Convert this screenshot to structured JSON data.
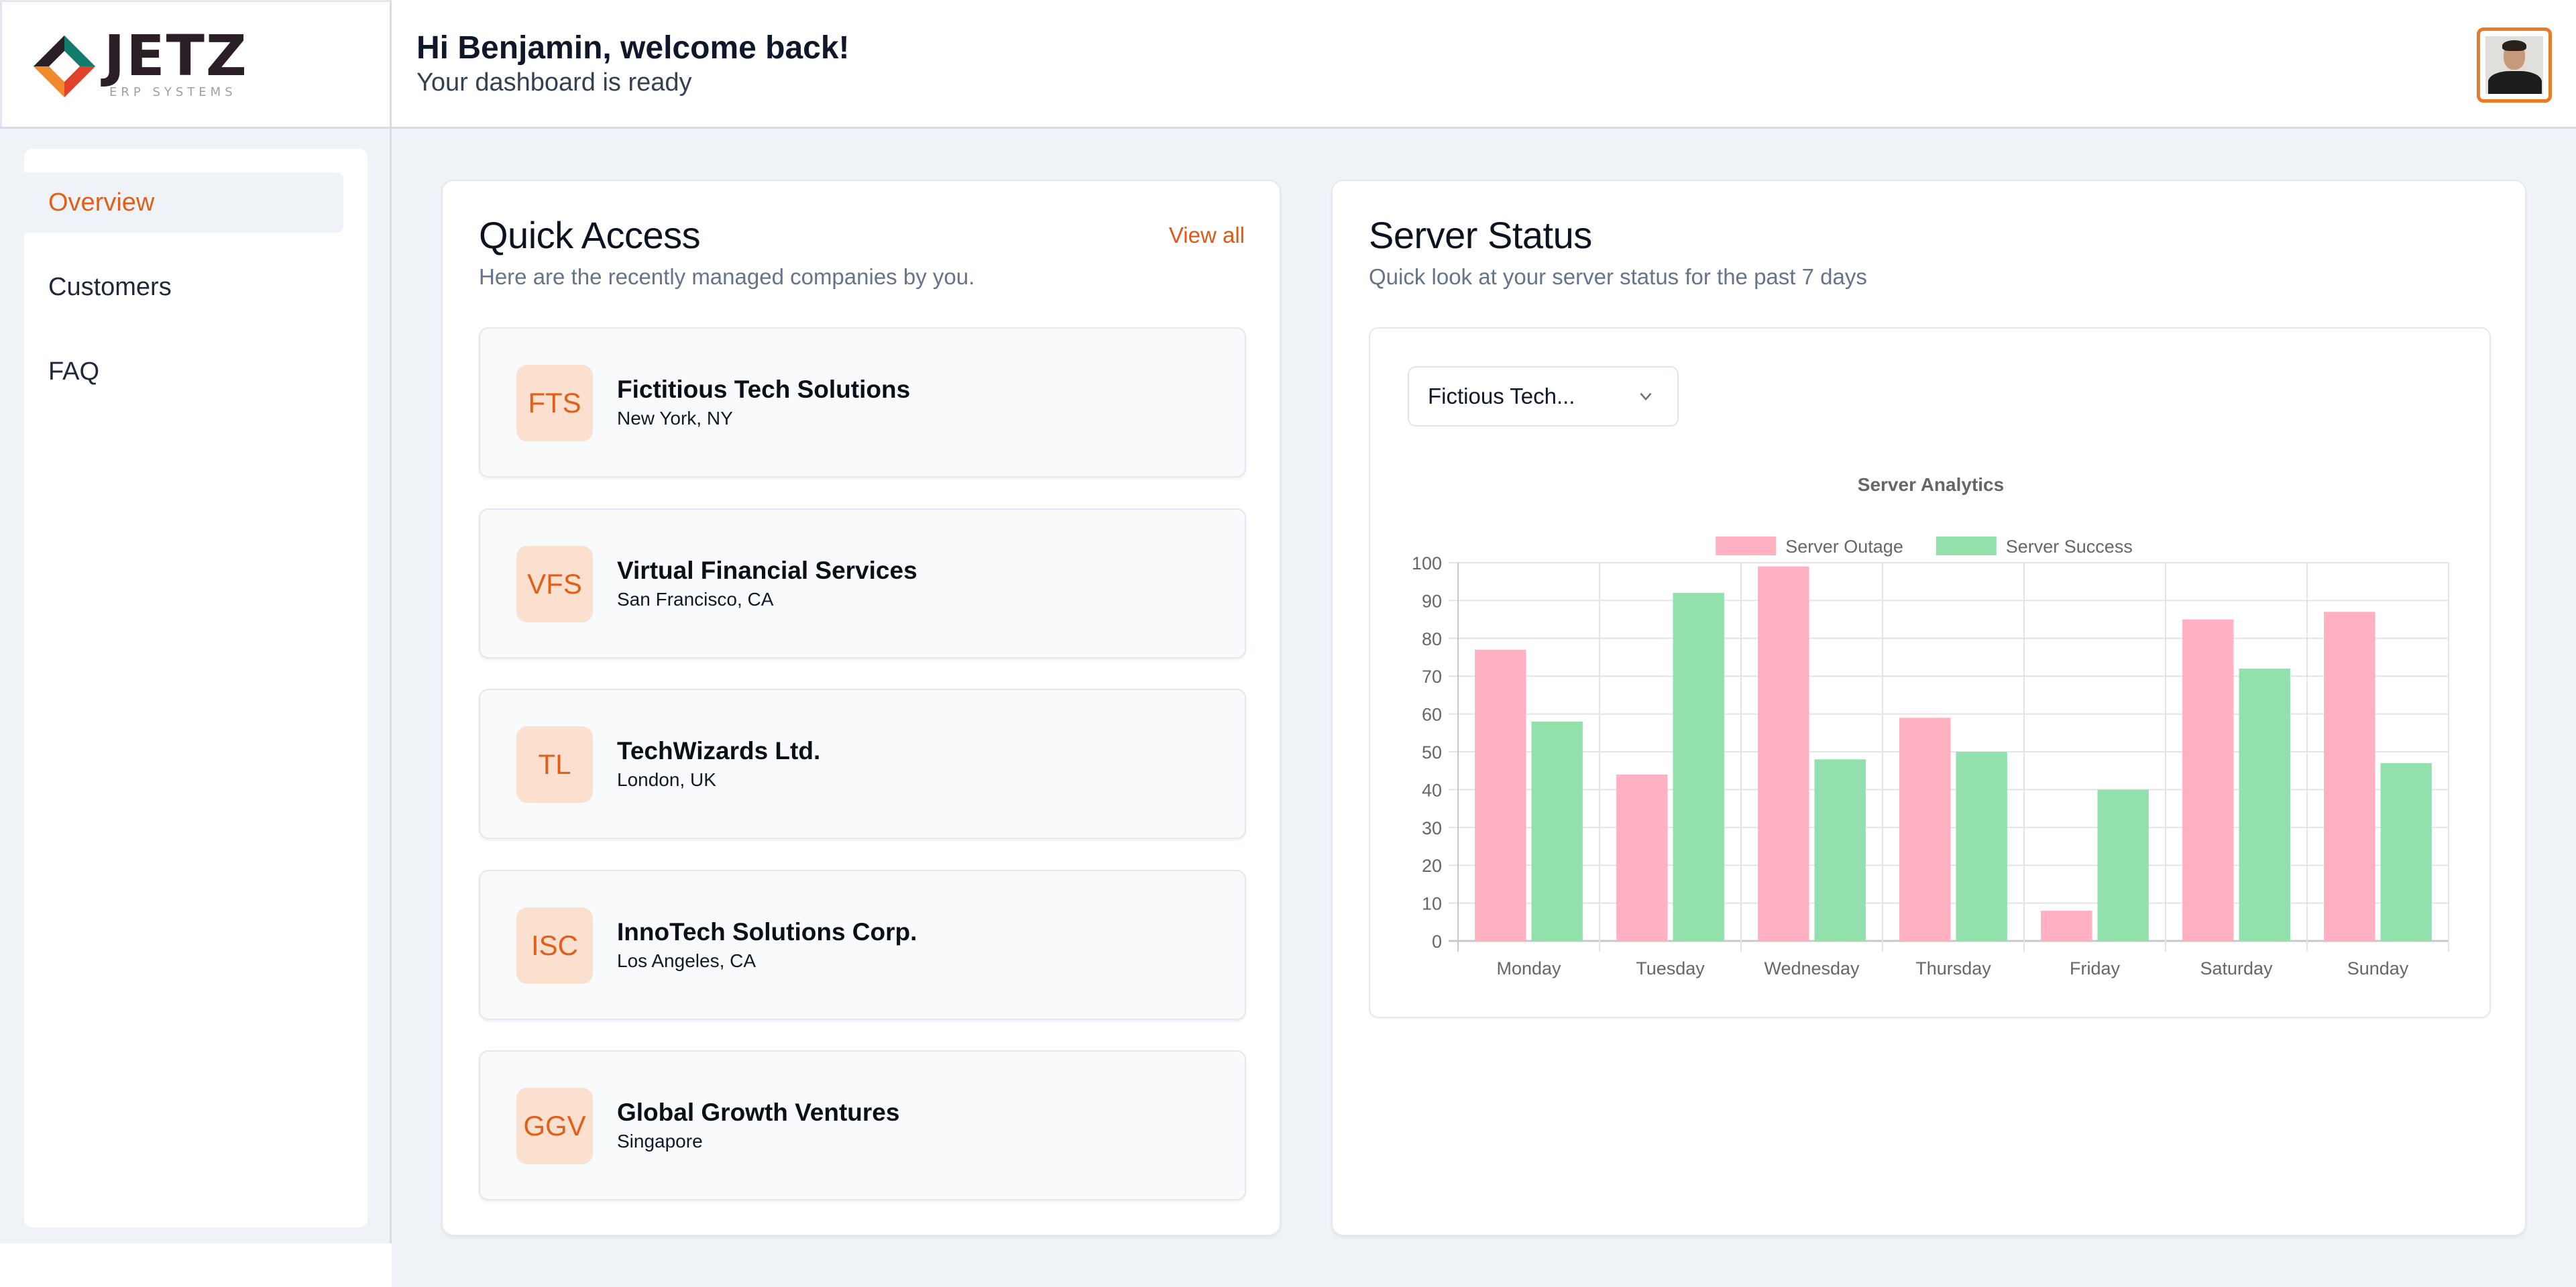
{
  "brand": {
    "name": "JETZ",
    "tagline": "ERP SYSTEMS",
    "colors": {
      "accent": "#e0601b",
      "avatar_border": "#ea7a26"
    }
  },
  "header": {
    "greeting": "Hi Benjamin, welcome back!",
    "subtitle": "Your dashboard is ready",
    "avatar_icon": "user-avatar"
  },
  "sidebar": {
    "items": [
      {
        "label": "Overview",
        "active": true
      },
      {
        "label": "Customers",
        "active": false
      },
      {
        "label": "FAQ",
        "active": false
      }
    ]
  },
  "quick_access": {
    "title": "Quick Access",
    "subtitle": "Here are the recently managed companies by you.",
    "view_all_label": "View all",
    "companies": [
      {
        "initials": "FTS",
        "name": "Fictitious Tech Solutions",
        "location": "New York, NY"
      },
      {
        "initials": "VFS",
        "name": "Virtual Financial Services",
        "location": "San Francisco, CA"
      },
      {
        "initials": "TL",
        "name": "TechWizards Ltd.",
        "location": "London, UK"
      },
      {
        "initials": "ISC",
        "name": "InnoTech Solutions Corp.",
        "location": "Los Angeles, CA"
      },
      {
        "initials": "GGV",
        "name": "Global Growth Ventures",
        "location": "Singapore"
      }
    ]
  },
  "server_status": {
    "title": "Server Status",
    "subtitle": "Quick look at your server status for the past 7 days",
    "company_select": {
      "value": "Fictious Tech...",
      "icon": "chevron-down-icon"
    }
  },
  "chart_data": {
    "type": "bar",
    "title": "Server Analytics",
    "categories": [
      "Monday",
      "Tuesday",
      "Wednesday",
      "Thursday",
      "Friday",
      "Saturday",
      "Sunday"
    ],
    "series": [
      {
        "name": "Server Outage",
        "color": "#ffb1c1",
        "values": [
          77,
          44,
          99,
          59,
          8,
          85,
          87
        ]
      },
      {
        "name": "Server Success",
        "color": "#92e1ad",
        "values": [
          58,
          92,
          48,
          50,
          40,
          72,
          47
        ]
      }
    ],
    "yticks": [
      0,
      10,
      20,
      30,
      40,
      50,
      60,
      70,
      80,
      90,
      100
    ],
    "ylim": [
      0,
      100
    ],
    "xlabel": "",
    "ylabel": "",
    "grid": true,
    "legend": "top-center"
  }
}
